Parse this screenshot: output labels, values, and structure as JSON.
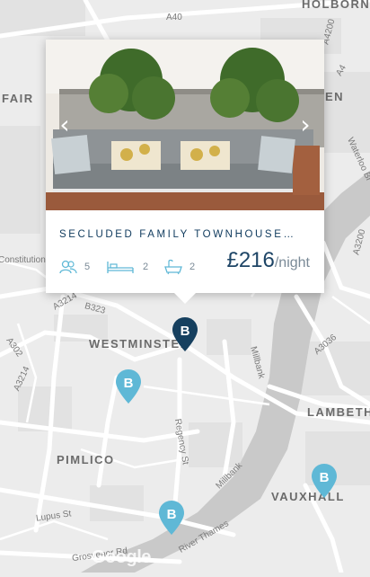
{
  "map": {
    "areas": [
      "HOLBORN",
      "FAIR",
      "EN",
      "WESTMINSTER",
      "LAMBETH",
      "PIMLICO",
      "VAUXHALL"
    ],
    "roads": [
      "A40",
      "A4200",
      "A4",
      "Waterloo Br",
      "A3200",
      "Constitution",
      "A3214",
      "B323",
      "A302",
      "A3214",
      "A3036",
      "Millbank",
      "Regency St",
      "Millbank",
      "Lupus St",
      "River Thames",
      "Grosvenor Rd"
    ],
    "attribution": "Google"
  },
  "listing": {
    "title": "SECLUDED FAMILY TOWNHOUSE…",
    "guests": "5",
    "beds": "2",
    "baths": "2",
    "price": "£216",
    "price_unit": "/night",
    "prev_icon": "chevron-left-icon",
    "next_icon": "chevron-right-icon"
  },
  "pins": {
    "selected_color": "#16405f",
    "default_color": "#5fb8d6",
    "glyph": "B"
  }
}
